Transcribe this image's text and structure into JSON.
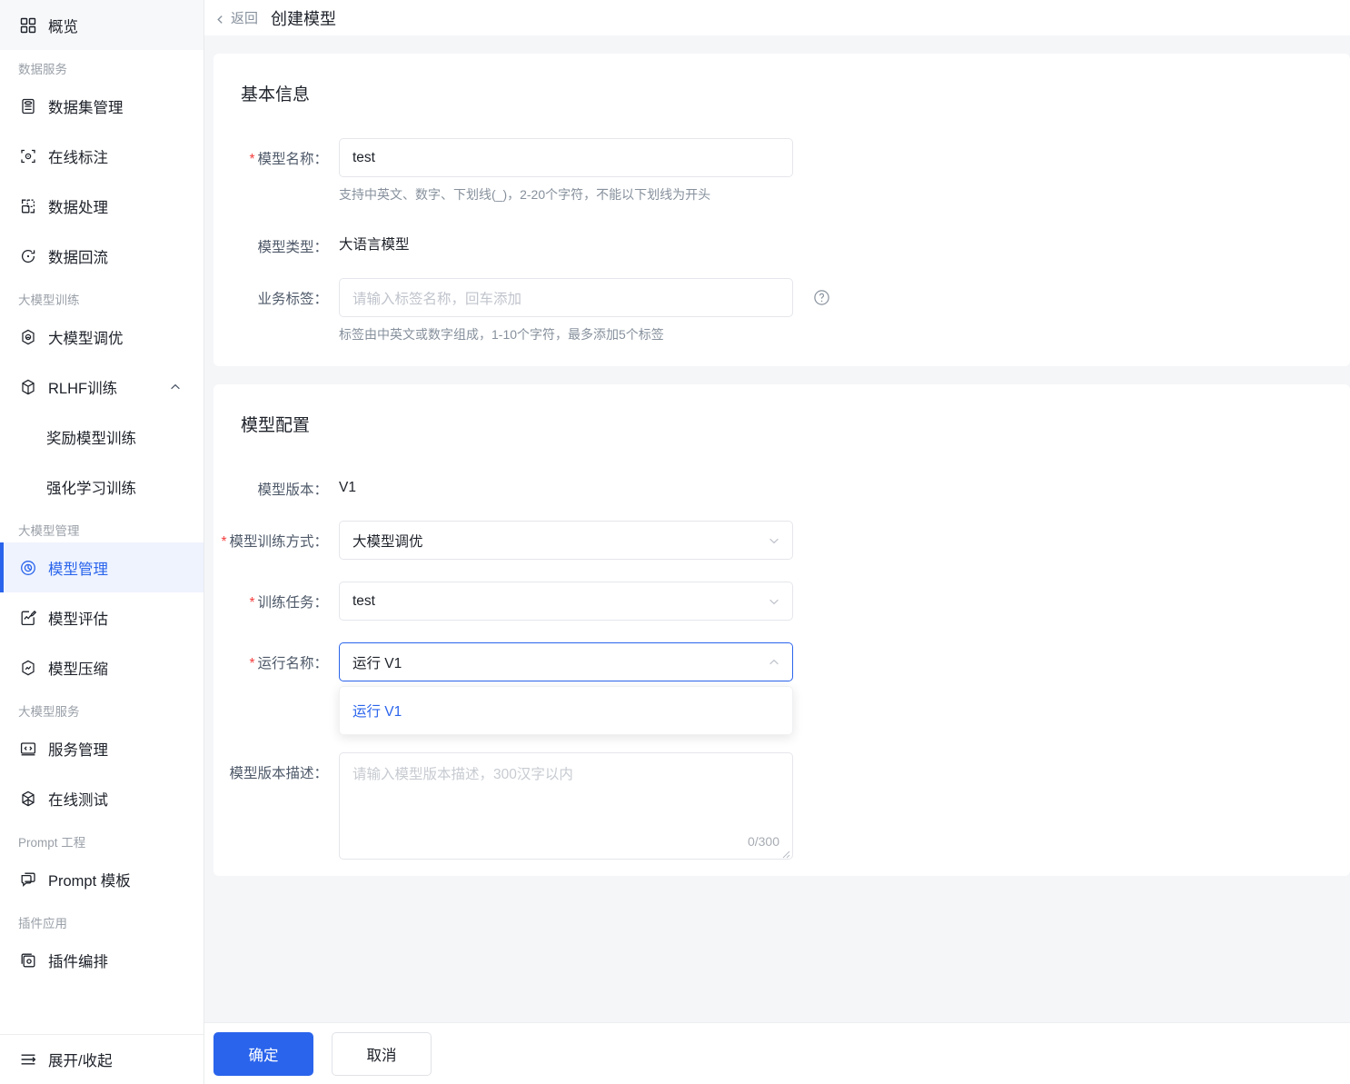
{
  "sidebar": {
    "top_item": {
      "label": "概览",
      "icon": "grid-icon"
    },
    "groups": [
      {
        "label": "数据服务",
        "items": [
          {
            "label": "数据集管理",
            "icon": "database-icon"
          },
          {
            "label": "在线标注",
            "icon": "annotate-icon"
          },
          {
            "label": "数据处理",
            "icon": "process-icon"
          },
          {
            "label": "数据回流",
            "icon": "refresh-icon"
          }
        ]
      },
      {
        "label": "大模型训练",
        "items": [
          {
            "label": "大模型调优",
            "icon": "tune-icon"
          },
          {
            "label": "RLHF训练",
            "icon": "cube-icon",
            "expanded": true,
            "children": [
              {
                "label": "奖励模型训练"
              },
              {
                "label": "强化学习训练"
              }
            ]
          }
        ]
      },
      {
        "label": "大模型管理",
        "items": [
          {
            "label": "模型管理",
            "icon": "model-icon",
            "active": true
          },
          {
            "label": "模型评估",
            "icon": "evaluate-icon"
          },
          {
            "label": "模型压缩",
            "icon": "compress-icon"
          }
        ]
      },
      {
        "label": "大模型服务",
        "items": [
          {
            "label": "服务管理",
            "icon": "code-window-icon"
          },
          {
            "label": "在线测试",
            "icon": "test-icon"
          }
        ]
      },
      {
        "label": "Prompt 工程",
        "items": [
          {
            "label": "Prompt 模板",
            "icon": "chat-template-icon"
          }
        ]
      },
      {
        "label": "插件应用",
        "items": [
          {
            "label": "插件编排",
            "icon": "plugin-icon"
          }
        ]
      }
    ],
    "collapse_toggle": {
      "label": "展开/收起",
      "icon": "menu-fold-icon"
    }
  },
  "header": {
    "back_label": "返回",
    "title": "创建模型"
  },
  "basic_info": {
    "section_title": "基本信息",
    "model_name": {
      "label": "模型名称：",
      "required": true,
      "value": "test",
      "hint": "支持中英文、数字、下划线(_)，2-20个字符，不能以下划线为开头"
    },
    "model_type": {
      "label": "模型类型：",
      "value": "大语言模型"
    },
    "business_tag": {
      "label": "业务标签：",
      "placeholder": "请输入标签名称，回车添加",
      "value": "",
      "hint": "标签由中英文或数字组成，1-10个字符，最多添加5个标签",
      "help_icon": "help-circle-icon"
    }
  },
  "model_config": {
    "section_title": "模型配置",
    "model_version": {
      "label": "模型版本：",
      "value": "V1"
    },
    "train_method": {
      "label": "模型训练方式：",
      "required": true,
      "value": "大模型调优"
    },
    "train_task": {
      "label": "训练任务：",
      "required": true,
      "value": "test"
    },
    "run_name": {
      "label": "运行名称：",
      "required": true,
      "value": "运行 V1",
      "open": true,
      "options": [
        {
          "label": "运行 V1",
          "selected": true
        }
      ]
    },
    "version_desc": {
      "label": "模型版本描述：",
      "placeholder": "请输入模型版本描述，300汉字以内",
      "value": "",
      "counter": "0/300"
    }
  },
  "footer": {
    "confirm_label": "确定",
    "cancel_label": "取消"
  },
  "colors": {
    "accent": "#2a64ec",
    "required_red": "#f53f3f",
    "page_bg": "#f5f6f8",
    "active_nav_bg": "#eef3fe"
  }
}
